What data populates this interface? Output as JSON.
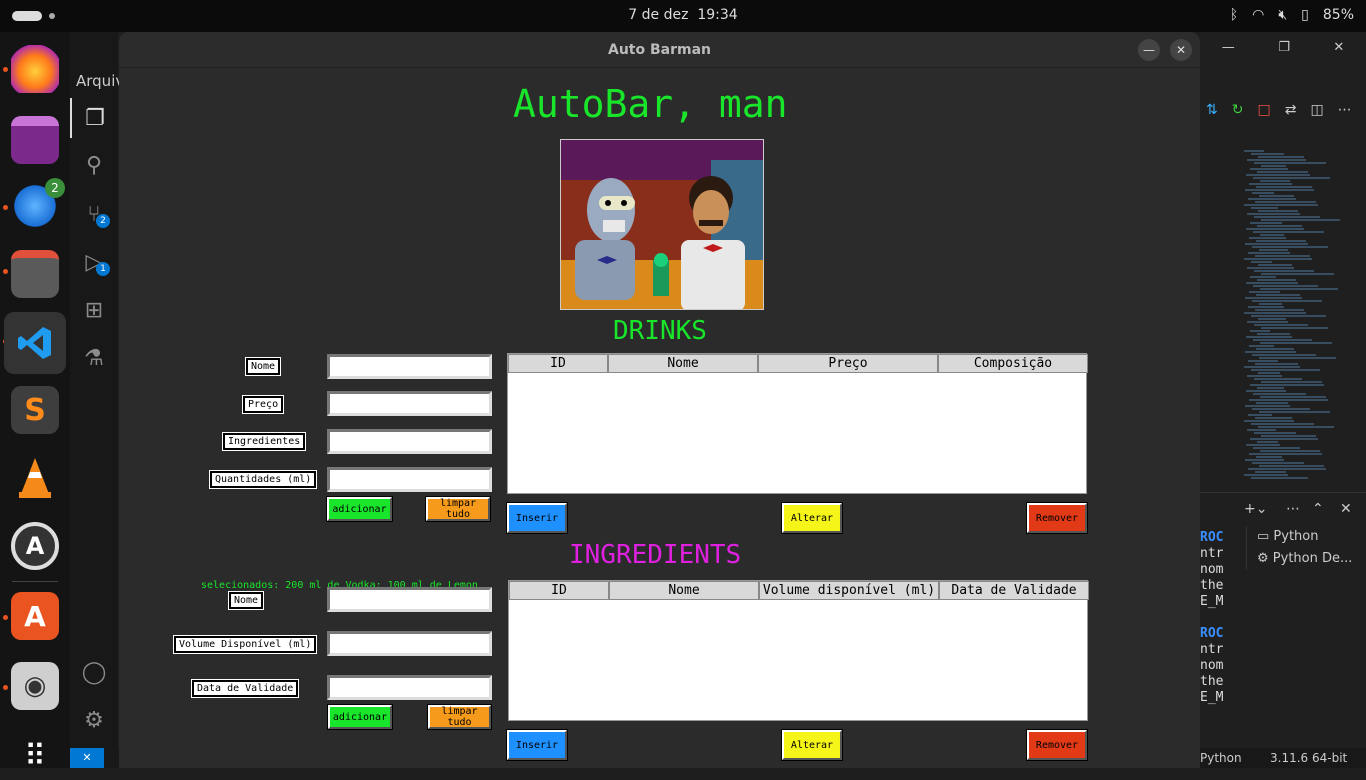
{
  "system": {
    "date": "7 de dez",
    "time": "19:34",
    "battery": "85%"
  },
  "dock": {
    "badges": {
      "thunderbird": "2"
    }
  },
  "vscode": {
    "menu_label": "Arquiv",
    "activity_badges": {
      "source_control": "2",
      "run_debug": "1"
    },
    "terminals": [
      "Python",
      "Python De..."
    ],
    "terminal_text": [
      "ROC",
      "ntr",
      "nom",
      "the",
      "E_M",
      "ROC",
      "ntr",
      "nom",
      "the",
      "E_M"
    ],
    "status": {
      "language": "Python",
      "interpreter": "3.11.6 64-bit"
    }
  },
  "window": {
    "title": "Auto Barman"
  },
  "app": {
    "title": "AutoBar, man",
    "drinks": {
      "section_title": "DRINKS",
      "form": {
        "nome_label": "Nome",
        "preco_label": "Preço",
        "ingredientes_label": "Ingredientes",
        "quantidades_label": "Quantidades (ml)",
        "nome_value": "",
        "preco_value": "",
        "ingredientes_value": "",
        "quantidades_value": "",
        "adicionar": "adicionar",
        "limpar": "limpar tudo",
        "selected_text": "selecionados: 200 ml de Vodka; 100 ml de Lemon"
      },
      "table": {
        "columns": [
          "ID",
          "Nome",
          "Preço",
          "Composição"
        ],
        "rows": []
      },
      "buttons": {
        "inserir": "Inserir",
        "alterar": "Alterar",
        "remover": "Remover"
      }
    },
    "ingredients": {
      "section_title": "INGREDIENTS",
      "form": {
        "nome_label": "Nome",
        "volume_label": "Volume Disponível (ml)",
        "validade_label": "Data de Validade",
        "nome_value": "",
        "volume_value": "",
        "validade_value": "",
        "adicionar": "adicionar",
        "limpar": "limpar tudo"
      },
      "table": {
        "columns": [
          "ID",
          "Nome",
          "Volume disponível (ml)",
          "Data de Validade"
        ],
        "rows": []
      },
      "buttons": {
        "inserir": "Inserir",
        "alterar": "Alterar",
        "remover": "Remover"
      }
    },
    "colors": {
      "title_green": "#19e62b",
      "ingredients_magenta": "#e020e0",
      "add_green": "#19e62b",
      "clear_orange": "#f59a1a",
      "insert_blue": "#1e90ff",
      "update_yellow": "#f5f51a",
      "remove_red": "#e23a16"
    }
  }
}
